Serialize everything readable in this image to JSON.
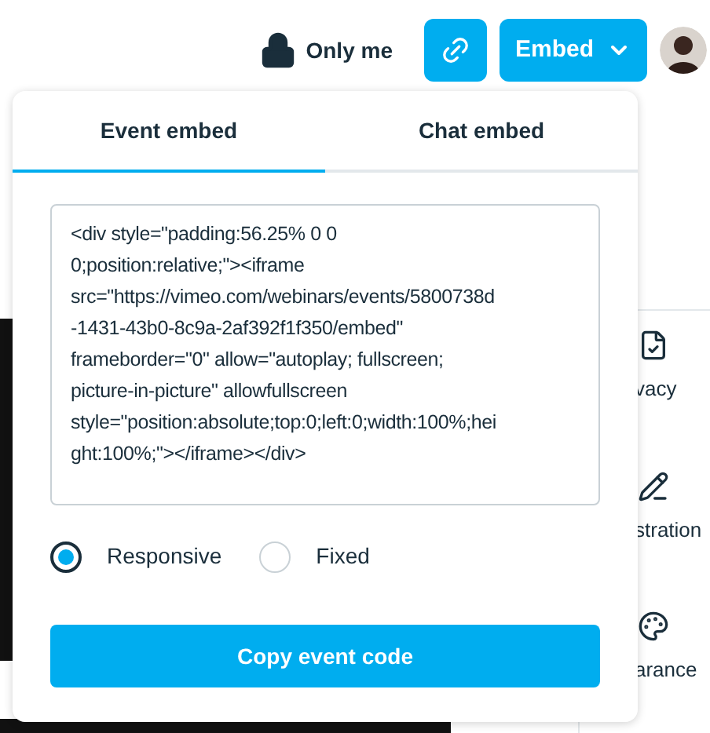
{
  "header": {
    "privacy_label": "Only me",
    "embed_button": "Embed"
  },
  "popup": {
    "tabs": [
      {
        "label": "Event embed",
        "selected": true
      },
      {
        "label": "Chat embed",
        "selected": false
      }
    ],
    "code": "<div style=\"padding:56.25% 0 0\n0;position:relative;\"><iframe\nsrc=\"https://vimeo.com/webinars/events/5800738d\n-1431-43b0-8c9a-2af392f1f350/embed\"\nframeborder=\"0\" allow=\"autoplay; fullscreen;\npicture-in-picture\" allowfullscreen\nstyle=\"position:absolute;top:0;left:0;width:100%;hei\nght:100%;\"></iframe></div>",
    "size_options": [
      {
        "label": "Responsive",
        "selected": true
      },
      {
        "label": "Fixed",
        "selected": false
      }
    ],
    "copy_button": "Copy event code"
  },
  "sidebar": {
    "items": [
      {
        "kind": "privacy",
        "label": "vacy"
      },
      {
        "kind": "registration",
        "label": "stration"
      },
      {
        "kind": "appearance",
        "label": "arance"
      }
    ]
  }
}
